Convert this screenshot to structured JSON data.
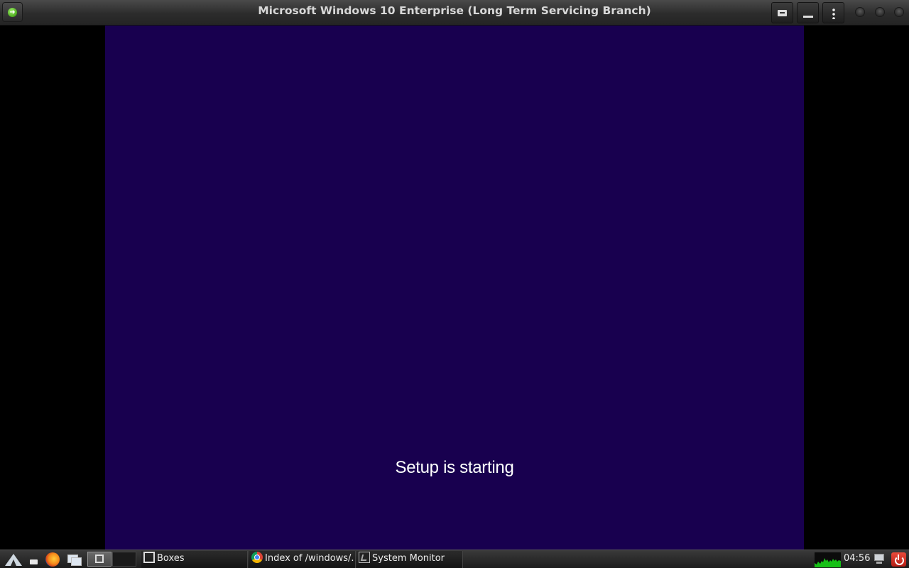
{
  "window": {
    "title": "Microsoft Windows 10 Enterprise (Long Term Servicing Branch)",
    "back_icon": "back-arrow-icon",
    "accent": "#4caa1e",
    "toolbar_icons": [
      "keyboard-icon",
      "minimize-icon",
      "menu-dots-icon"
    ]
  },
  "vm": {
    "screen_color": "#18004f",
    "message": "Setup is starting"
  },
  "taskbar": {
    "launchers": [
      "arch-menu-icon",
      "show-desktop-icon",
      "firefox-icon",
      "windows-switcher-icon"
    ],
    "workspaces": [
      "workspace-1",
      "workspace-2"
    ],
    "tasks": [
      {
        "label": "Boxes",
        "icon": "boxes-icon"
      },
      {
        "label": "Index of /windows/...",
        "icon": "chrome-icon"
      },
      {
        "label": "System Monitor",
        "icon": "system-monitor-icon"
      }
    ],
    "clock": "04:56",
    "tray_icons": [
      "cpu-graph-icon",
      "network-icon",
      "power-icon"
    ],
    "power_color": "#d2332a"
  }
}
